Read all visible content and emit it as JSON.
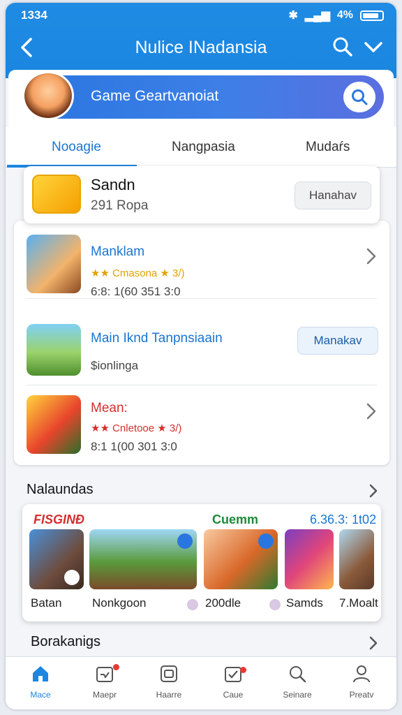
{
  "status": {
    "time": "1334",
    "battery": "4%"
  },
  "appbar": {
    "title": "Nulice INadansia"
  },
  "search": {
    "placeholder": "Game Geartvanoiat"
  },
  "tabs": [
    {
      "label": "Nooagie",
      "active": true
    },
    {
      "label": "Nangpasia",
      "active": false
    },
    {
      "label": "Mudaŕs",
      "active": false
    }
  ],
  "featured": {
    "name": "Sandn",
    "subtitle": "291 Ropa",
    "button": "Hanahav"
  },
  "list": [
    {
      "title": "Manklam",
      "rating": "★★ Cmasona ★ 3/)",
      "meta": "6:8: 1(60 351 3:0",
      "action": "arrow"
    },
    {
      "title": "Main Iknd Tanpnsiaain",
      "rating": "",
      "meta": "$ionlinga",
      "action": "button",
      "button": "Manakav"
    },
    {
      "title": "Mean:",
      "rating": "★★ Cnletooe ★ 3/)",
      "meta": "8:1 1(00 301 3:0",
      "action": "arrow"
    }
  ],
  "sections": {
    "first": "Nalaundas",
    "second": "Borakanigs"
  },
  "carousel": {
    "labels": [
      "FISGINÐ",
      "Cuemm",
      "6.36.3: 1t02"
    ],
    "tiles": [
      {
        "caption": "Batan"
      },
      {
        "caption": "Nonkgoon"
      },
      {
        "caption": "200dle"
      },
      {
        "caption": "Samds"
      },
      {
        "caption": "7.Moalt"
      }
    ]
  },
  "bottom_nav": [
    {
      "label": "Mace",
      "icon": "home-icon",
      "active": true
    },
    {
      "label": "Maepr",
      "icon": "inbox-icon",
      "active": false
    },
    {
      "label": "Haarre",
      "icon": "gallery-icon",
      "active": false
    },
    {
      "label": "Caue",
      "icon": "check-icon",
      "active": false
    },
    {
      "label": "Seinare",
      "icon": "search-icon",
      "active": false
    },
    {
      "label": "Preatv",
      "icon": "profile-icon",
      "active": false
    }
  ],
  "colors": {
    "primary": "#1e86e0",
    "accent_red": "#d32f2f",
    "star": "#e0a200"
  }
}
